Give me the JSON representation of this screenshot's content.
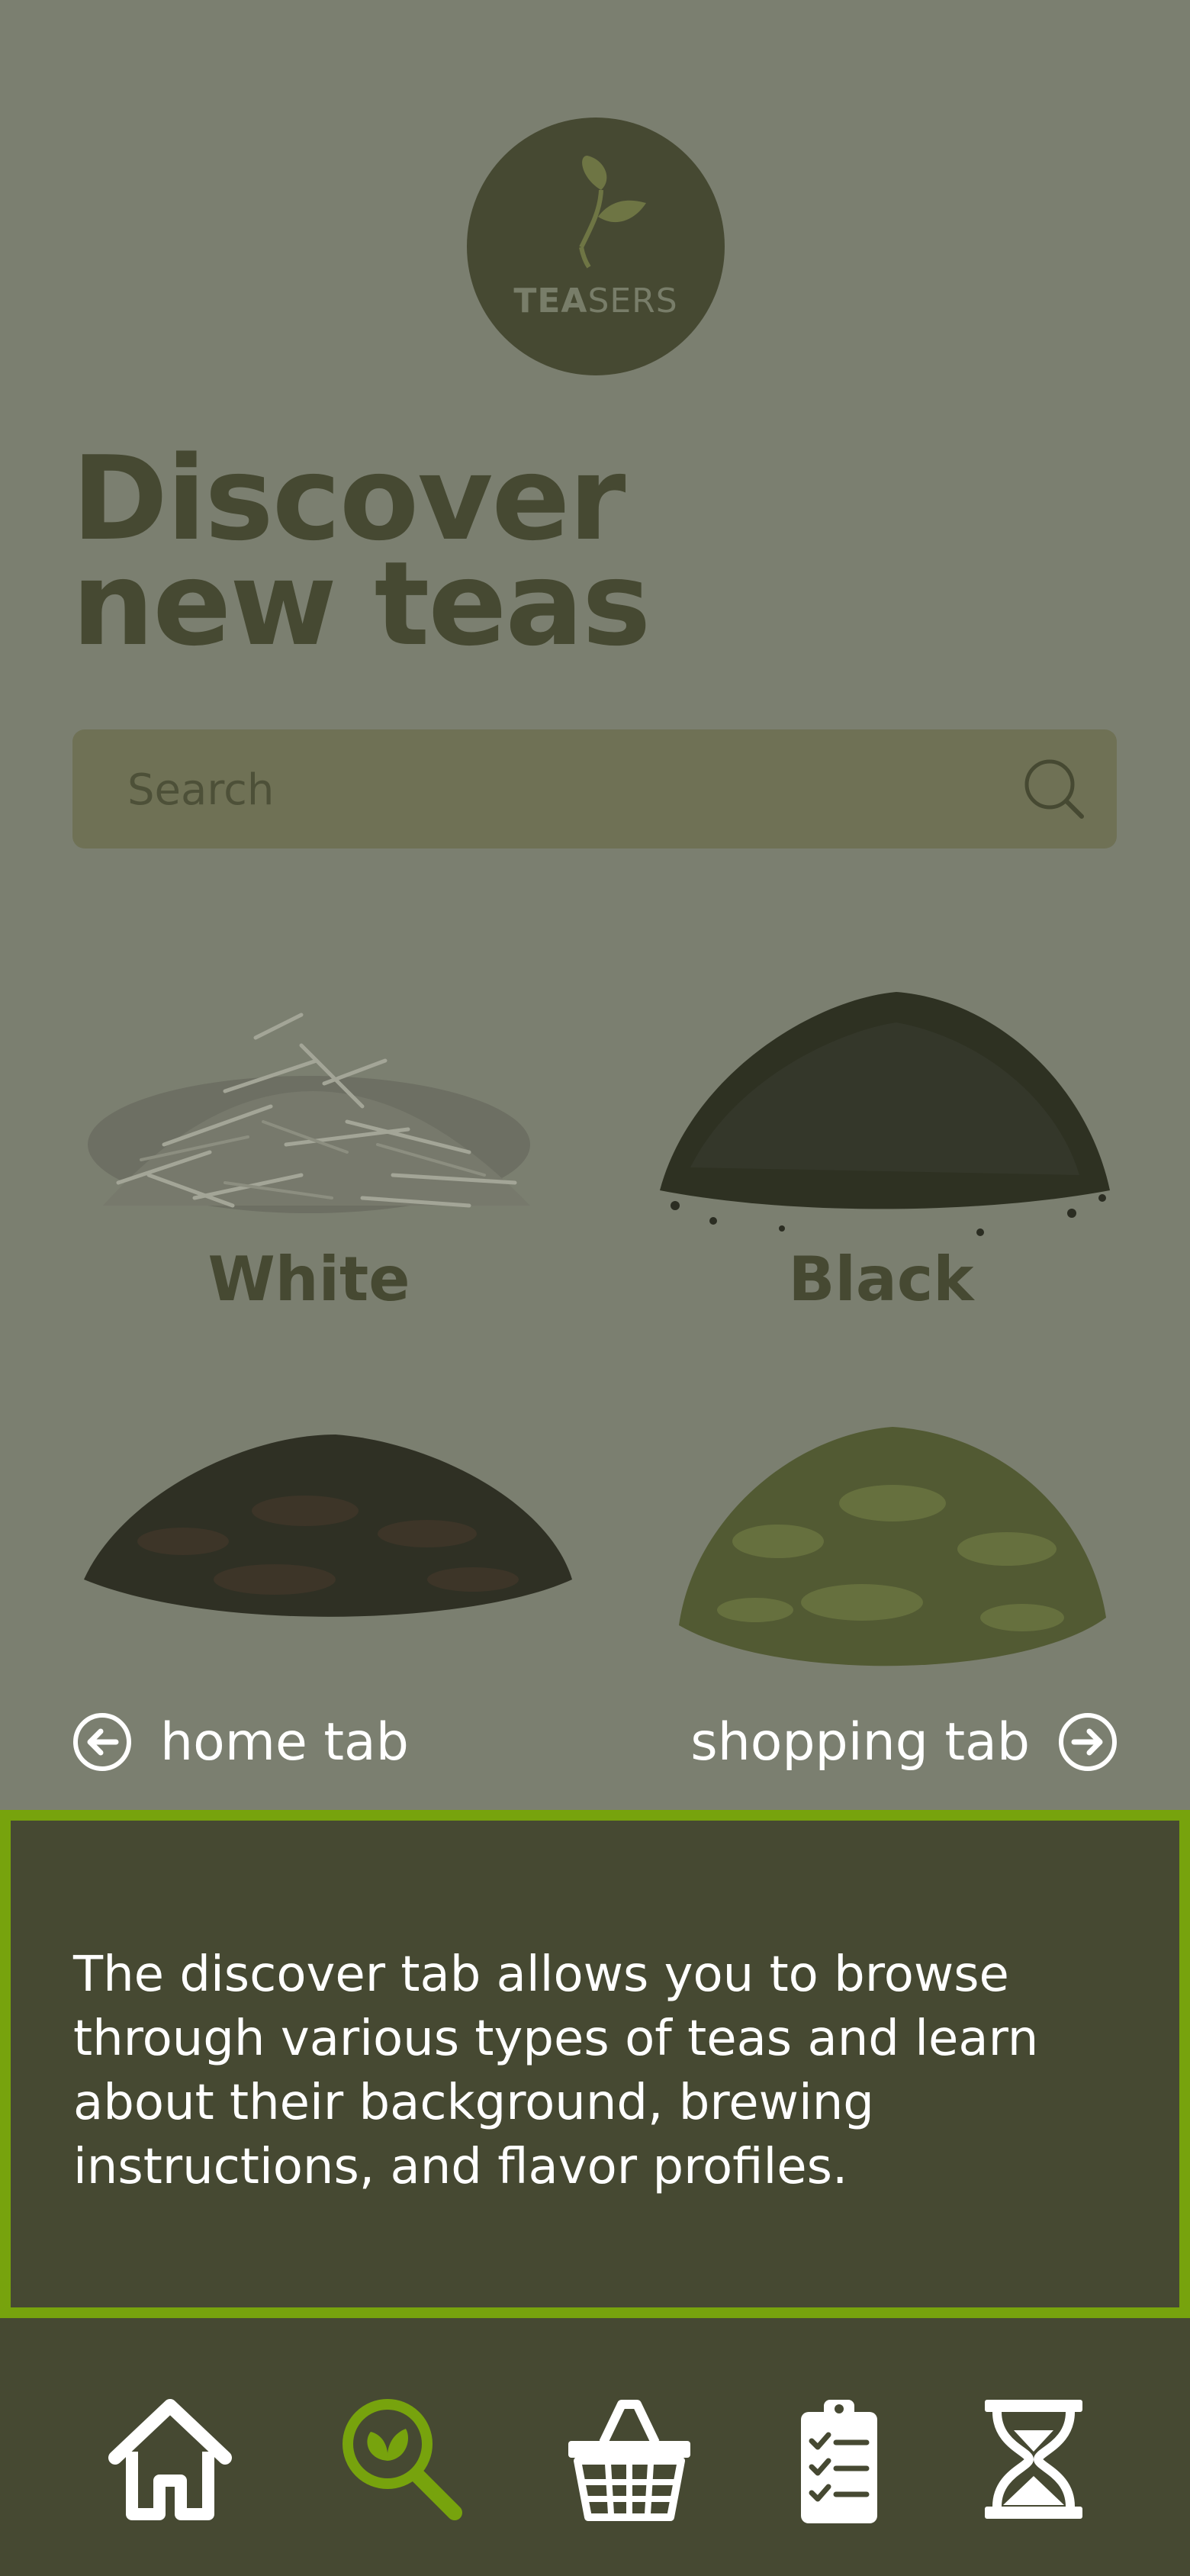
{
  "logo": {
    "brand_bold": "TEA",
    "brand_light": "SERS",
    "icon": "leaf-icon"
  },
  "title": {
    "line1": "Discover",
    "line2": "new teas"
  },
  "search": {
    "placeholder": "Search",
    "icon": "search-icon"
  },
  "teas": [
    {
      "label": "White",
      "image": "white-tea-leaves"
    },
    {
      "label": "Black",
      "image": "black-tea-leaves"
    },
    {
      "label": "",
      "image": "oolong-tea-leaves"
    },
    {
      "label": "",
      "image": "green-tea-leaves"
    }
  ],
  "tab_nav": {
    "prev_label": "home tab",
    "prev_icon": "arrow-left-circle-icon",
    "next_label": "shopping tab",
    "next_icon": "arrow-right-circle-icon"
  },
  "info": {
    "text": "The discover tab allows you to browse through various types of teas and learn about their background, brewing instructions, and flavor profiles."
  },
  "bottom_nav": {
    "items": [
      {
        "name": "home",
        "icon": "home-icon",
        "active": false
      },
      {
        "name": "discover",
        "icon": "search-leaf-icon",
        "active": true
      },
      {
        "name": "shop",
        "icon": "basket-icon",
        "active": false
      },
      {
        "name": "orders",
        "icon": "clipboard-icon",
        "active": false
      },
      {
        "name": "timer",
        "icon": "hourglass-icon",
        "active": false
      }
    ]
  },
  "colors": {
    "background": "#7b7f70",
    "dark": "#464932",
    "accent": "#77a30d",
    "text_light": "#ffffff"
  }
}
